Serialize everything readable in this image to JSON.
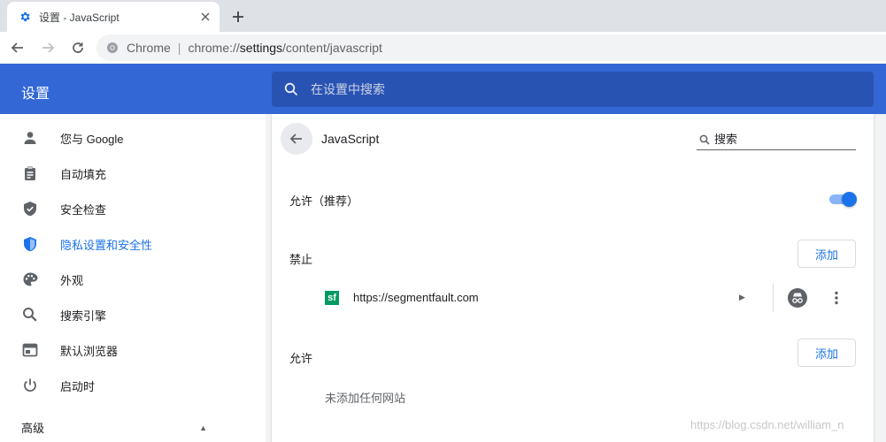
{
  "browser": {
    "tab_title": "设置 - JavaScript",
    "chip_label": "Chrome",
    "url_scheme": "chrome://",
    "url_host": "settings",
    "url_path": "/content/javascript"
  },
  "header": {
    "app_title": "设置",
    "search_placeholder": "在设置中搜索"
  },
  "sidebar": {
    "items": [
      {
        "label": "您与 Google",
        "icon": "person-icon"
      },
      {
        "label": "自动填充",
        "icon": "clipboard-icon"
      },
      {
        "label": "安全检查",
        "icon": "shield-check-icon"
      },
      {
        "label": "隐私设置和安全性",
        "icon": "shield-privacy-icon",
        "active": true
      },
      {
        "label": "外观",
        "icon": "palette-icon"
      },
      {
        "label": "搜索引擎",
        "icon": "search-icon"
      },
      {
        "label": "默认浏览器",
        "icon": "browser-window-icon"
      },
      {
        "label": "启动时",
        "icon": "power-icon"
      }
    ],
    "advanced_label": "高级"
  },
  "page": {
    "title": "JavaScript",
    "search_placeholder": "搜索",
    "allow_recommended_label": "允许（推荐）",
    "allow_toggle_on": true,
    "block_section_label": "禁止",
    "block_add_label": "添加",
    "blocked_sites": [
      {
        "url": "https://segmentfault.com",
        "icon_text": "sf"
      }
    ],
    "allow_section_label": "允许",
    "allow_add_label": "添加",
    "allow_empty_message": "未添加任何网站"
  },
  "watermark": "https://blog.csdn.net/william_n",
  "colors": {
    "header_bg": "#3367d6",
    "accent": "#1a73e8",
    "sf_green": "#009a61"
  }
}
